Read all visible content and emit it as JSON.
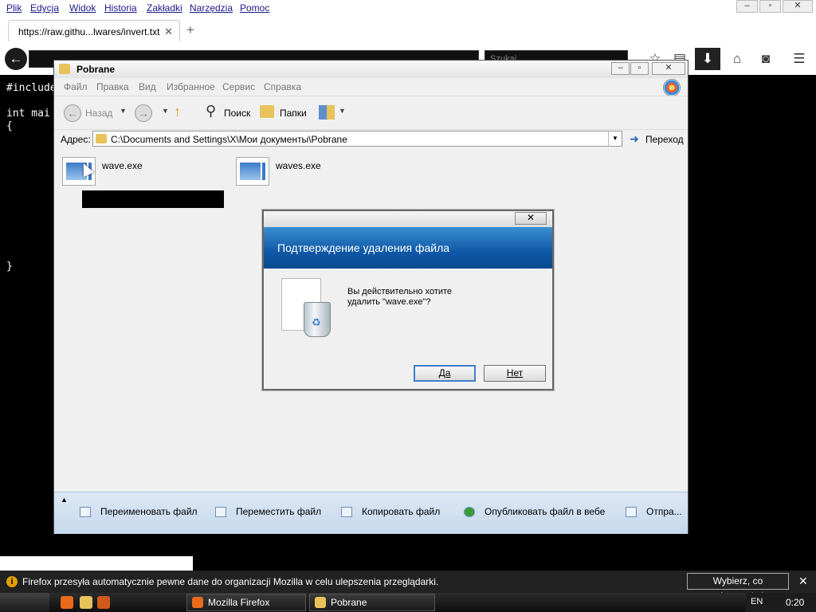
{
  "firefox": {
    "menu": [
      "Plik",
      "Edycja",
      "Widok",
      "Historia",
      "Zakładki",
      "Narzędzia",
      "Pomoc"
    ],
    "tab_title": "https://raw.githu...lwares/invert.txt",
    "new_tab_symbol": "+",
    "search_placeholder": "Szukaj",
    "notification": "Firefox przesyła automatycznie pewne dane do organizacji Mozilla w celu ulepszenia przeglądarki.",
    "notification_button": "Wybierz, co udostępniać"
  },
  "page": {
    "code_lines": [
      "#include",
      "int mai",
      "{",
      "}"
    ]
  },
  "explorer": {
    "title": "Pobrane",
    "menu": [
      "Файл",
      "Правка",
      "Вид",
      "Избранное",
      "Сервис",
      "Справка"
    ],
    "toolbar": {
      "back": "Назад",
      "search": "Поиск",
      "folders": "Папки"
    },
    "address_label": "Адрес:",
    "address_path": "C:\\Documents and Settings\\X\\Мои документы\\Pobrane",
    "go_label": "Переход",
    "files": [
      {
        "name": "wave.exe"
      },
      {
        "name": "waves.exe"
      }
    ],
    "tasks": [
      "Переименовать файл",
      "Переместить файл",
      "Копировать файл",
      "Опубликовать файл в вебе",
      "Отпра..."
    ]
  },
  "dialog": {
    "heading": "Подтверждение удаления файла",
    "message_line1": "Вы действительно хотите",
    "message_line2": "удалить \"wave.exe\"?",
    "yes": "Да",
    "no": "Нет"
  },
  "taskbar": {
    "tasks": [
      "Mozilla Firefox",
      "Pobrane"
    ],
    "lang": "EN",
    "clock": "0:20"
  },
  "icons": {
    "firefox": "firefox-icon",
    "folder": "folder-icon",
    "recycle_bin": "recycle-bin-icon",
    "info": "info-icon"
  },
  "colors": {
    "dialog_header": "#0f58a6",
    "tasks_pane": "#c6d8ec",
    "notification_bg": "#222222"
  }
}
